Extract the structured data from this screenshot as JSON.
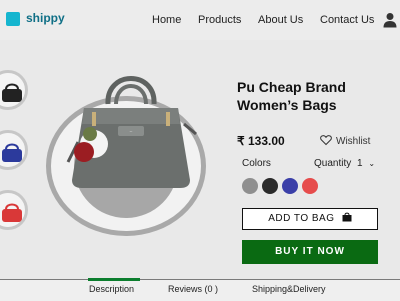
{
  "brand": {
    "name": "shippy",
    "logo_color": "#15b5cf"
  },
  "nav": {
    "items": [
      "Home",
      "Products",
      "About Us",
      "Contact Us"
    ],
    "user_icon": "user-icon"
  },
  "gallery": {
    "thumbnails": [
      {
        "color_name": "black",
        "color": "#222222"
      },
      {
        "color_name": "blue",
        "color": "#2c3a9c"
      },
      {
        "color_name": "red",
        "color": "#d93838"
      }
    ],
    "main_image_color": "#6b6f6d"
  },
  "product": {
    "title_line1": "Pu Cheap Brand",
    "title_line2": "Women’s Bags",
    "price": "₹ 133.00",
    "wishlist_label": "Wishlist",
    "colors_label": "Colors",
    "quantity_label": "Quantity",
    "quantity_value": "1",
    "swatches": [
      "#8f8f8f",
      "#2b2b2b",
      "#3b3fa8",
      "#e64c4c"
    ],
    "add_to_bag_label": "ADD TO BAG",
    "buy_now_label": "BUY IT NOW",
    "buy_now_color": "#0a6a12"
  },
  "tabs": {
    "items": [
      "Description",
      "Reviews (0 )",
      "Shipping&Delivery"
    ],
    "active": "Description",
    "active_color": "#0b7d2d"
  }
}
